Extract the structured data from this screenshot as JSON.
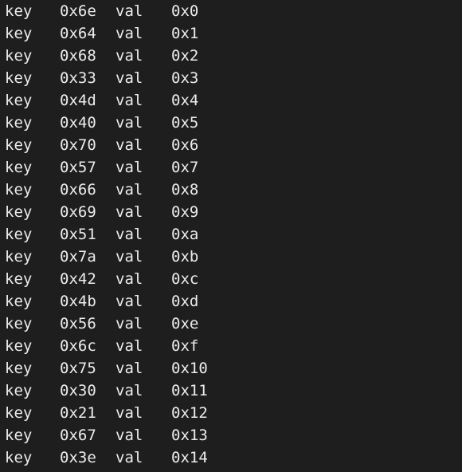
{
  "terminal": {
    "background": "#1e1e1e",
    "text_color": "#ececec",
    "key_label": "key",
    "val_label": "val",
    "rows": [
      {
        "key": "0x6e",
        "val": "0x0"
      },
      {
        "key": "0x64",
        "val": "0x1"
      },
      {
        "key": "0x68",
        "val": "0x2"
      },
      {
        "key": "0x33",
        "val": "0x3"
      },
      {
        "key": "0x4d",
        "val": "0x4"
      },
      {
        "key": "0x40",
        "val": "0x5"
      },
      {
        "key": "0x70",
        "val": "0x6"
      },
      {
        "key": "0x57",
        "val": "0x7"
      },
      {
        "key": "0x66",
        "val": "0x8"
      },
      {
        "key": "0x69",
        "val": "0x9"
      },
      {
        "key": "0x51",
        "val": "0xa"
      },
      {
        "key": "0x7a",
        "val": "0xb"
      },
      {
        "key": "0x42",
        "val": "0xc"
      },
      {
        "key": "0x4b",
        "val": "0xd"
      },
      {
        "key": "0x56",
        "val": "0xe"
      },
      {
        "key": "0x6c",
        "val": "0xf"
      },
      {
        "key": "0x75",
        "val": "0x10"
      },
      {
        "key": "0x30",
        "val": "0x11"
      },
      {
        "key": "0x21",
        "val": "0x12"
      },
      {
        "key": "0x67",
        "val": "0x13"
      },
      {
        "key": "0x3e",
        "val": "0x14"
      }
    ]
  }
}
